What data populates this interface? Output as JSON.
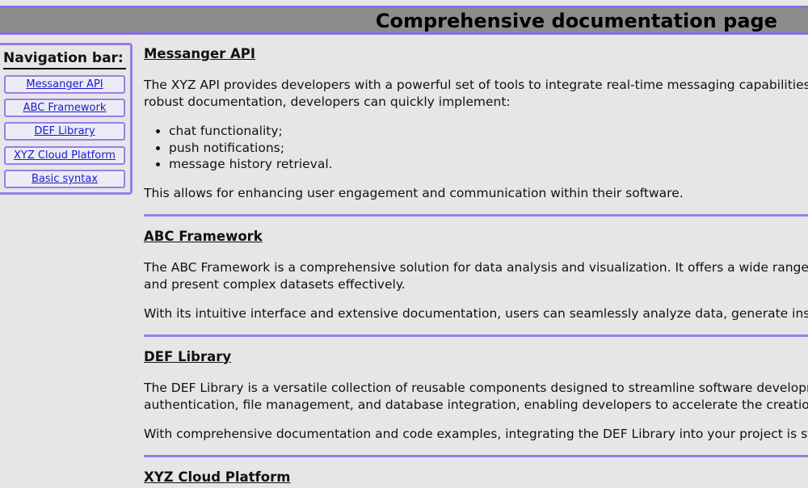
{
  "header": {
    "title": "Comprehensive documentation page"
  },
  "sidebar": {
    "title": "Navigation bar:",
    "items": [
      {
        "label": "Messanger API"
      },
      {
        "label": "ABC Framework"
      },
      {
        "label": "DEF Library"
      },
      {
        "label": "XYZ Cloud Platform"
      },
      {
        "label": "Basic syntax"
      }
    ]
  },
  "sections": [
    {
      "heading": "Messanger API",
      "p1_line1": "The XYZ API provides developers with a powerful set of tools to integrate real-time messaging capabilities",
      "p1_line2": "robust documentation, developers can quickly implement:",
      "list": [
        "chat functionality;",
        "push notifications;",
        "message history retrieval."
      ],
      "p2": "This allows for enhancing user engagement and communication within their software."
    },
    {
      "heading": "ABC Framework",
      "p1_line1": "The ABC Framework is a comprehensive solution for data analysis and visualization. It offers a wide range",
      "p1_line2": "and present complex datasets effectively.",
      "p2": "With its intuitive interface and extensive documentation, users can seamlessly analyze data, generate insi"
    },
    {
      "heading": "DEF Library",
      "p1_line1": "The DEF Library is a versatile collection of reusable components designed to streamline software developm",
      "p1_line2": "authentication, file management, and database integration, enabling developers to accelerate the creation",
      "p2": "With comprehensive documentation and code examples, integrating the DEF Library into your project is st"
    },
    {
      "heading": "XYZ Cloud Platform"
    }
  ],
  "colors": {
    "accent": "#9a7de8",
    "header_bg": "#8c8c8c",
    "page_bg": "#e6e6e6",
    "link": "#1a1acc"
  }
}
